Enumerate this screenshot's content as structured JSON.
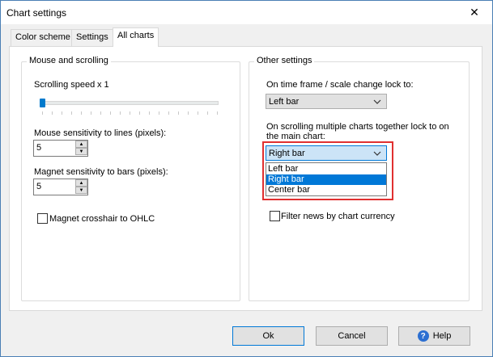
{
  "window": {
    "title": "Chart settings",
    "close_label": "✕"
  },
  "tabs": [
    {
      "label": "Color scheme"
    },
    {
      "label": "Settings"
    },
    {
      "label": "All charts"
    }
  ],
  "mouse_group": {
    "legend": "Mouse and scrolling",
    "scrolling_speed_label": "Scrolling speed",
    "scrolling_speed_value": "x  1",
    "scrolling_speed_level": 1,
    "sensitivity_lines_label": "Mouse sensitivity to lines (pixels):",
    "sensitivity_lines_value": "5",
    "magnet_bars_label": "Magnet sensitivity to bars (pixels):",
    "magnet_bars_value": "5",
    "magnet_crosshair_label": "Magnet crosshair to OHLC",
    "magnet_crosshair_checked": false
  },
  "other_group": {
    "legend": "Other settings",
    "timeframe_lock_label": "On time frame / scale change lock to:",
    "timeframe_lock_value": "Left bar",
    "scroll_lock_label_line1": "On scrolling multiple charts together lock to on",
    "scroll_lock_label_line2": "the main chart:",
    "scroll_lock_value": "Right bar",
    "scroll_lock_options": [
      "Left bar",
      "Right bar",
      "Center bar"
    ],
    "scroll_lock_highlighted": "Right bar",
    "filter_news_label": "Filter news by chart currency",
    "filter_news_checked": false
  },
  "buttons": {
    "ok": "Ok",
    "cancel": "Cancel",
    "help": "Help",
    "help_icon_glyph": "?"
  },
  "colors": {
    "accent": "#0078d7",
    "highlight_border": "#e03030",
    "slider_thumb": "#007acc"
  }
}
